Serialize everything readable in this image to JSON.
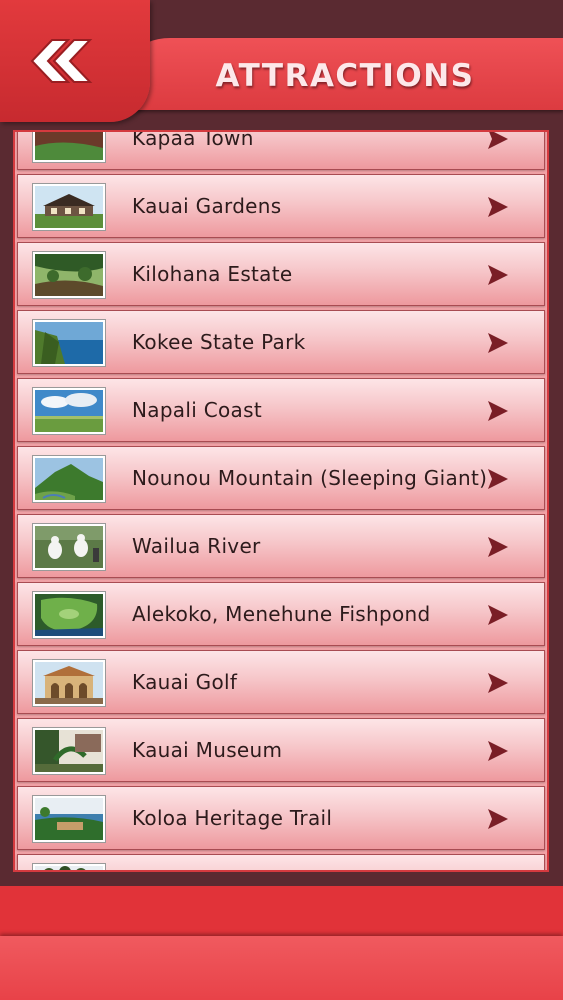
{
  "header": {
    "title": "ATTRACTIONS",
    "back_icon": "double-chevron-left-icon"
  },
  "list": {
    "items": [
      {
        "label": "Kapaa Town",
        "thumb": "coast-cliffs"
      },
      {
        "label": "Kauai Gardens",
        "thumb": "lodge-house"
      },
      {
        "label": "Kilohana Estate",
        "thumb": "green-valley"
      },
      {
        "label": "Kokee State Park",
        "thumb": "canyon-ocean"
      },
      {
        "label": "Napali Coast",
        "thumb": "sky-clouds"
      },
      {
        "label": "Nounou Mountain (Sleeping Giant)",
        "thumb": "green-mountain"
      },
      {
        "label": "Wailua River",
        "thumb": "birds-field"
      },
      {
        "label": "Alekoko, Menehune Fishpond",
        "thumb": "aerial-green"
      },
      {
        "label": "Kauai Golf",
        "thumb": "historic-building"
      },
      {
        "label": "Kauai Museum",
        "thumb": "palm-plants"
      },
      {
        "label": "Koloa Heritage Trail",
        "thumb": "beach-resort"
      },
      {
        "label": "",
        "thumb": "tree-line"
      }
    ],
    "row_icon": "chevron-right-icon"
  },
  "colors": {
    "accent": "#e23a3d",
    "background": "#5a2a31",
    "row_light": "#fde5e7",
    "row_dark": "#ee999e"
  }
}
